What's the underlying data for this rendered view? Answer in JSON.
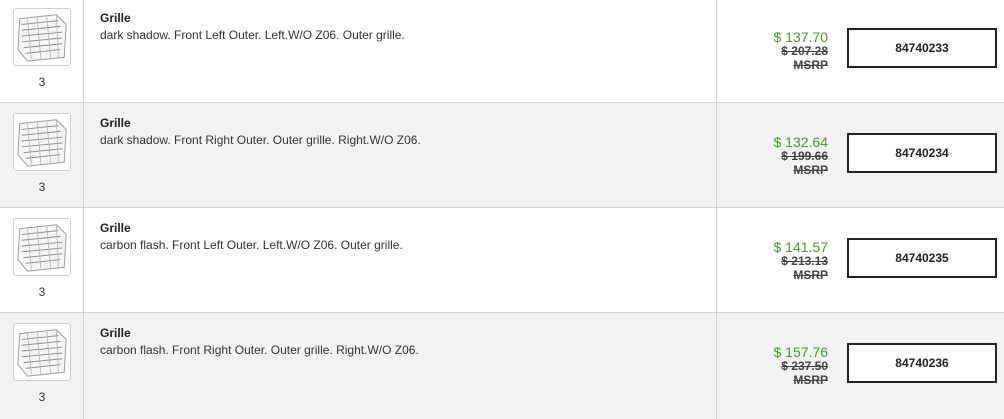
{
  "parts": [
    {
      "title": "Grille",
      "description": "dark shadow. Front Left Outer. Left.W/O Z06. Outer grille.",
      "quantity": "3",
      "price": "$ 137.70",
      "msrp_value": "$ 207.28",
      "msrp_label": "MSRP",
      "part_number": "84740233",
      "thumbnail_icon": "grille-icon"
    },
    {
      "title": "Grille",
      "description": "dark shadow. Front Right Outer. Outer grille. Right.W/O Z06.",
      "quantity": "3",
      "price": "$ 132.64",
      "msrp_value": "$ 199.66",
      "msrp_label": "MSRP",
      "part_number": "84740234",
      "thumbnail_icon": "grille-icon"
    },
    {
      "title": "Grille",
      "description": "carbon flash. Front Left Outer. Left.W/O Z06. Outer grille.",
      "quantity": "3",
      "price": "$ 141.57",
      "msrp_value": "$ 213.13",
      "msrp_label": "MSRP",
      "part_number": "84740235",
      "thumbnail_icon": "grille-icon"
    },
    {
      "title": "Grille",
      "description": "carbon flash. Front Right Outer. Outer grille. Right.W/O Z06.",
      "quantity": "3",
      "price": "$ 157.76",
      "msrp_value": "$ 237.50",
      "msrp_label": "MSRP",
      "part_number": "84740236",
      "thumbnail_icon": "grille-icon"
    }
  ],
  "colors": {
    "price": "#4a9a2c",
    "row_alt_background": "#f3f3f3",
    "border": "#d4d4d4"
  }
}
